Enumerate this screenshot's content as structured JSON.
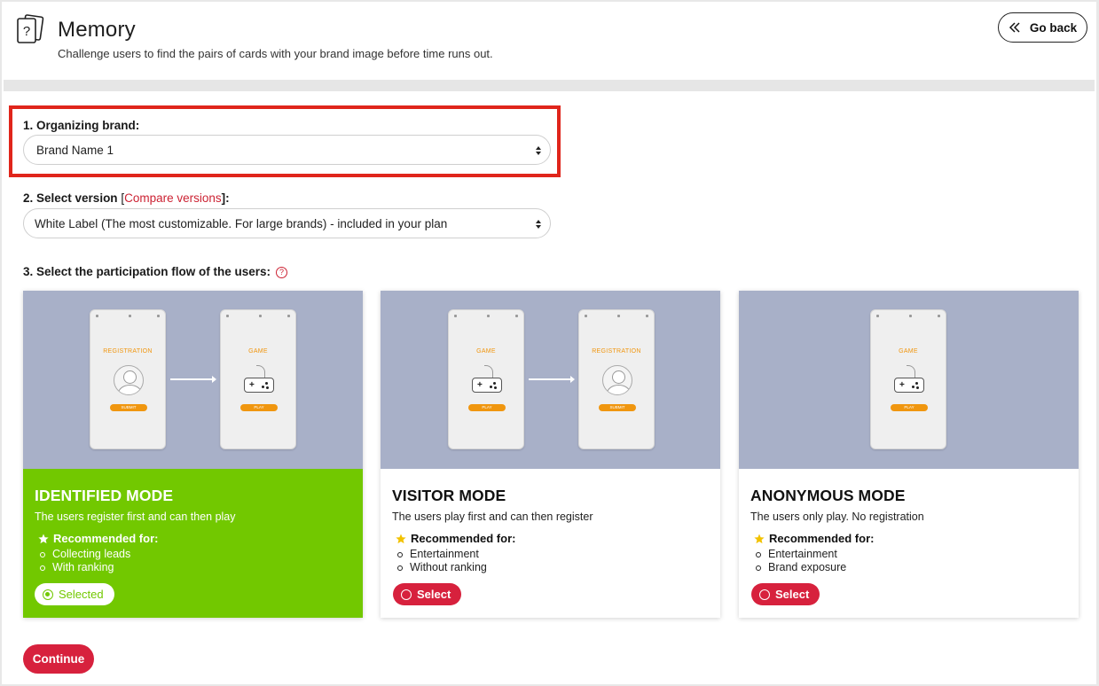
{
  "header": {
    "title": "Memory",
    "subtitle": "Challenge users to find the pairs of cards with your brand image before time runs out.",
    "go_back_label": "Go back"
  },
  "step1": {
    "label": "1. Organizing brand:",
    "selected_value": "Brand Name 1"
  },
  "step2": {
    "label": "2. Select version",
    "compare_link_open": "[",
    "compare_link": "Compare versions",
    "compare_link_close": "]:",
    "selected_value": "White Label (The most customizable. For large brands) - included in your plan"
  },
  "step3": {
    "label": "3. Select the participation flow of the users:",
    "help_icon": "?"
  },
  "phone_labels": {
    "registration": "REGISTRATION",
    "game": "GAME",
    "submit": "SUBMIT",
    "play": "PLAY"
  },
  "cards": [
    {
      "mode": "IDENTIFIED MODE",
      "description": "The users register first and can then play",
      "recommended_label": "Recommended for:",
      "items": [
        "Collecting leads",
        "With ranking"
      ],
      "button_label": "Selected",
      "selected": true
    },
    {
      "mode": "VISITOR MODE",
      "description": "The users play first and can then register",
      "recommended_label": "Recommended for:",
      "items": [
        "Entertainment",
        "Without ranking"
      ],
      "button_label": "Select",
      "selected": false
    },
    {
      "mode": "ANONYMOUS MODE",
      "description": "The users only play. No registration",
      "recommended_label": "Recommended for:",
      "items": [
        "Entertainment",
        "Brand exposure"
      ],
      "button_label": "Select",
      "selected": false
    }
  ],
  "continue_label": "Continue",
  "colors": {
    "accent_red": "#d7213d",
    "selected_green": "#72c800",
    "highlight_box": "#e0251b",
    "illustration_bg": "#a8b0c8",
    "phone_accent": "#f0960f",
    "star_yellow": "#f2c200"
  }
}
